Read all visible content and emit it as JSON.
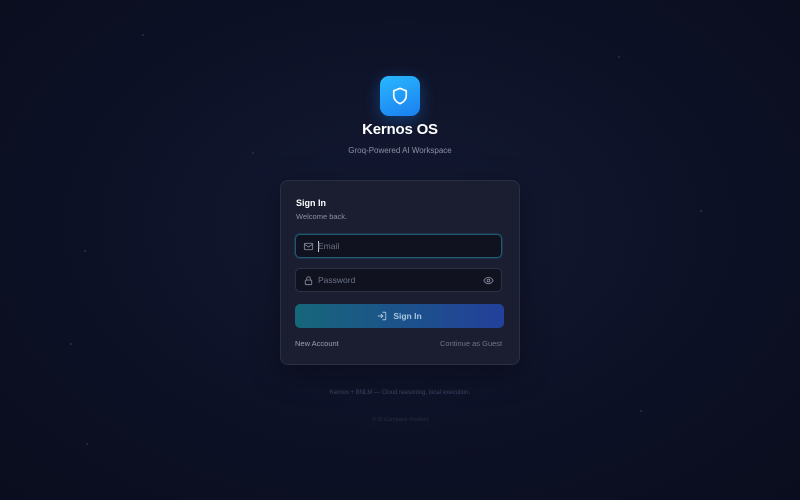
{
  "app": {
    "title": "Kernos OS",
    "subtitle": "Groq-Powered AI Workspace"
  },
  "signin": {
    "title": "Sign In",
    "subtitle": "Welcome back.",
    "email_placeholder": "Email",
    "email_value": "",
    "password_placeholder": "Password",
    "password_value": "",
    "button_label": "Sign In",
    "new_account_label": "New Account",
    "guest_label": "Continue as Guest"
  },
  "footer": {
    "tagline": "Kernos + BNLM — Cloud reasoning, local execution.",
    "copyright": "© Di Company Product"
  },
  "icons": {
    "logo": "shield-icon",
    "email": "mail-icon",
    "password": "lock-icon",
    "show_password": "eye-icon",
    "signin": "login-icon"
  },
  "colors": {
    "accent": "#1a7ff0",
    "background": "#0d1126",
    "card": "#1a1e30",
    "button_start": "#17667a",
    "button_end": "#23409a"
  }
}
